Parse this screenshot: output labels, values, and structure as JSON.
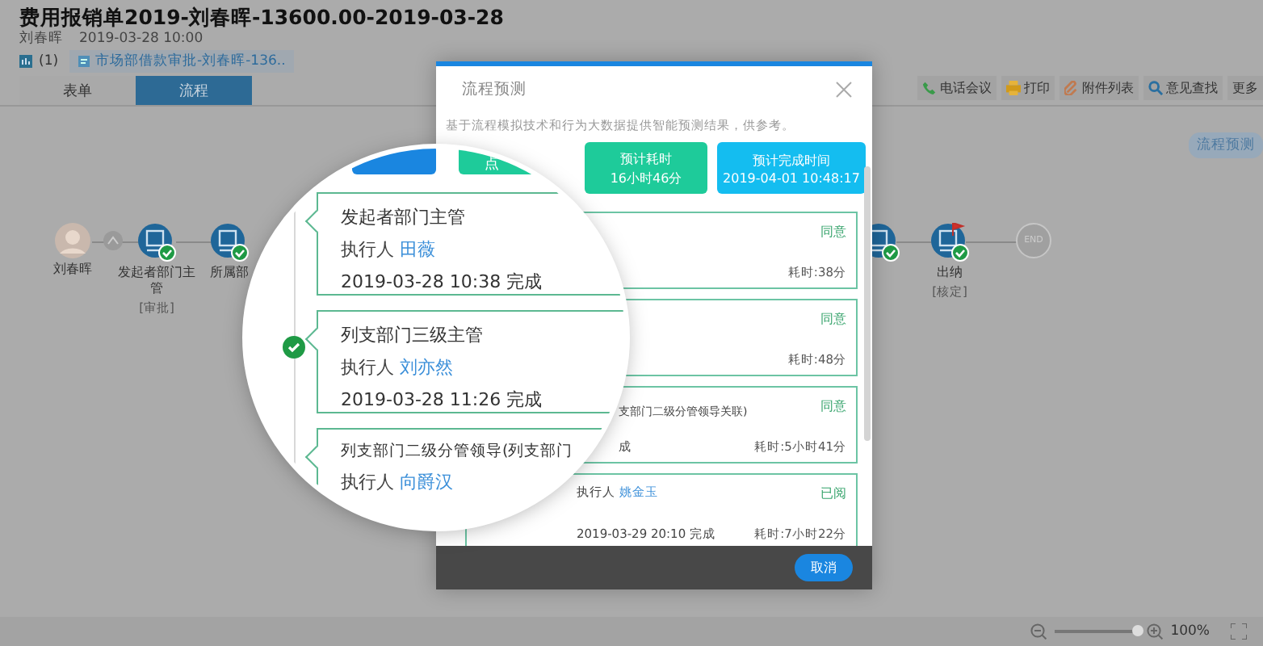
{
  "document": {
    "title": "费用报销单2019-刘春晖-13600.00-2019-03-28",
    "author": "刘春晖",
    "created": "2019-03-28 10:00",
    "attachment_count": "(1)",
    "attachment": "市场部借款审批-刘春晖-136.."
  },
  "tabs": [
    {
      "label": "表单",
      "selected": false
    },
    {
      "label": "流程",
      "selected": true
    }
  ],
  "toolbar": [
    {
      "kind": "phone",
      "label": "电话会议"
    },
    {
      "kind": "print",
      "label": "打印"
    },
    {
      "kind": "attach",
      "label": "附件列表"
    },
    {
      "kind": "search",
      "label": "意见查找"
    },
    {
      "kind": "more",
      "label": "更多"
    }
  ],
  "predict_button": "流程预测",
  "flow": [
    {
      "kind": "person",
      "name": "刘春晖"
    },
    {
      "kind": "gateway"
    },
    {
      "kind": "step",
      "name": "发起者部门主管",
      "action": "[审批]",
      "done": true,
      "flagged": false
    },
    {
      "kind": "step",
      "name": "所属部",
      "done": true,
      "flagged": false
    },
    {
      "kind": "step",
      "done": true
    },
    {
      "kind": "step",
      "name": "出纳",
      "action": "[核定]",
      "done": true,
      "flagged": true
    },
    {
      "kind": "end",
      "name": "END"
    }
  ],
  "dialog": {
    "title": "流程预测",
    "description": "基于流程模拟技术和行为大数据提供智能预测结果，供参考。",
    "summary": [
      {
        "label": "预计耗时",
        "value": "16小时46分",
        "color": "#1ecb9a"
      },
      {
        "label": "预计完成时间",
        "value": "2019-04-01 10:48:17",
        "color": "#14bdf0"
      }
    ],
    "steps": [
      {
        "status": "同意",
        "duration": "耗时:38分"
      },
      {
        "status": "同意",
        "duration": "耗时:48分"
      },
      {
        "title": "支部门二级分管领导关联)",
        "status": "同意",
        "time": "成",
        "duration": "耗时:5小时41分"
      },
      {
        "status": "已阅",
        "executor_label": "执行人",
        "executor": "姚金玉",
        "time": "2019-03-29 20:10 完成",
        "duration": "耗时:7小时22分"
      }
    ],
    "cancel": "取消"
  },
  "magnifier": {
    "tiles": [
      {
        "color": "#1a86e0"
      },
      {
        "color": "#1ecb9a",
        "label": "点"
      }
    ],
    "steps": [
      {
        "title": "发起者部门主管",
        "executor_label": "执行人",
        "executor": "田薇",
        "time": "2019-03-28 10:38 完成",
        "done": false
      },
      {
        "title": "列支部门三级主管",
        "executor_label": "执行人",
        "executor": "刘亦然",
        "time": "2019-03-28 11:26 完成",
        "done": true
      },
      {
        "title": "列支部门二级分管领导(列支部门",
        "executor_label": "执行人",
        "executor": "向爵汉",
        "done": false
      }
    ]
  },
  "zoom": {
    "level": 1,
    "reading": "100%"
  }
}
